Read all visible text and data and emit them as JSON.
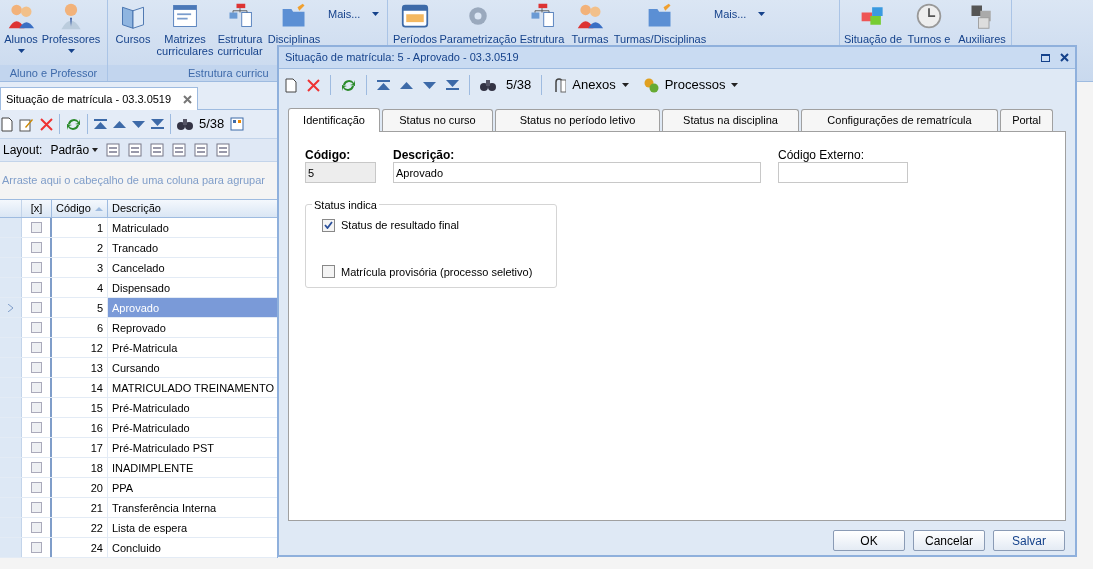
{
  "ribbon": {
    "groups": [
      {
        "label": "Aluno e Professor",
        "buttons": [
          {
            "label": "Alunos",
            "dropdown": true
          },
          {
            "label": "Professores",
            "dropdown": true
          }
        ]
      },
      {
        "label": "Estrutura curricu",
        "buttons": [
          {
            "label": "Cursos",
            "dropdown": false
          },
          {
            "label": "Matrizes curriculares",
            "dropdown": false
          },
          {
            "label": "Estrutura curricular",
            "dropdown": false
          },
          {
            "label": "Disciplinas",
            "dropdown": false
          }
        ],
        "more": "Mais..."
      },
      {
        "buttons": [
          {
            "label": "Períodos",
            "dropdown": false
          },
          {
            "label": "Parametrização",
            "dropdown": false
          },
          {
            "label": "Estrutura",
            "dropdown": false
          },
          {
            "label": "Turmas",
            "dropdown": false
          },
          {
            "label": "Turmas/Disciplinas",
            "dropdown": false
          }
        ],
        "more": "Mais..."
      },
      {
        "buttons": [
          {
            "label": "Situação de",
            "dropdown": false
          },
          {
            "label": "Turnos e",
            "dropdown": false
          },
          {
            "label": "Auxiliares",
            "dropdown": false
          }
        ]
      }
    ]
  },
  "document_tab": {
    "title": "Situação de matrícula - 03.3.0519"
  },
  "toolbar": {
    "record_counter": "5/38"
  },
  "layout_bar": {
    "label": "Layout:",
    "preset": "Padrão"
  },
  "group_panel": {
    "hint": "Arraste aqui o cabeçalho de uma coluna para agrupar"
  },
  "grid": {
    "columns": [
      "[x]",
      "Código",
      "Descrição"
    ],
    "rows": [
      {
        "code": "1",
        "description": "Matriculado",
        "checked": false,
        "selected": false
      },
      {
        "code": "2",
        "description": "Trancado",
        "checked": false,
        "selected": false
      },
      {
        "code": "3",
        "description": "Cancelado",
        "checked": false,
        "selected": false
      },
      {
        "code": "4",
        "description": "Dispensado",
        "checked": false,
        "selected": false
      },
      {
        "code": "5",
        "description": "Aprovado",
        "checked": false,
        "selected": true
      },
      {
        "code": "6",
        "description": "Reprovado",
        "checked": false,
        "selected": false
      },
      {
        "code": "12",
        "description": "Pré-Matricula",
        "checked": false,
        "selected": false
      },
      {
        "code": "13",
        "description": "Cursando",
        "checked": false,
        "selected": false
      },
      {
        "code": "14",
        "description": "MATRICULADO TREINAMENTO",
        "checked": false,
        "selected": false
      },
      {
        "code": "15",
        "description": "Pré-Matriculado",
        "checked": false,
        "selected": false
      },
      {
        "code": "16",
        "description": "Pré-Matriculado",
        "checked": false,
        "selected": false
      },
      {
        "code": "17",
        "description": "Pré-Matriculado PST",
        "checked": false,
        "selected": false
      },
      {
        "code": "18",
        "description": "INADIMPLENTE",
        "checked": false,
        "selected": false
      },
      {
        "code": "20",
        "description": "PPA",
        "checked": false,
        "selected": false
      },
      {
        "code": "21",
        "description": "Transferência Interna",
        "checked": false,
        "selected": false
      },
      {
        "code": "22",
        "description": "Lista de espera",
        "checked": false,
        "selected": false
      },
      {
        "code": "24",
        "description": "Concluido",
        "checked": false,
        "selected": false
      }
    ]
  },
  "dialog": {
    "title": "Situação de matrícula: 5 - Aprovado - 03.3.0519",
    "toolbar": {
      "record_counter": "5/38",
      "menus": [
        "Anexos",
        "Processos"
      ]
    },
    "tabs": [
      {
        "label": "Identificação",
        "selected": true
      },
      {
        "label": "Status no curso",
        "selected": false
      },
      {
        "label": "Status no período letivo",
        "selected": false
      },
      {
        "label": "Status na disciplina",
        "selected": false
      },
      {
        "label": "Configurações de rematrícula",
        "selected": false
      },
      {
        "label": "Portal",
        "selected": false
      }
    ],
    "fields": [
      {
        "label": "Código:",
        "value": "5",
        "disabled": true
      },
      {
        "label": "Descrição:",
        "value": "Aprovado",
        "disabled": false
      },
      {
        "label": "Código Externo:",
        "disabled": false
      }
    ],
    "status_group": {
      "title": "Status indica",
      "options": [
        {
          "label": "Status de resultado final",
          "checked": true
        },
        {
          "label": "Matrícula provisória (processo seletivo)",
          "checked": false
        }
      ]
    },
    "buttons": [
      "OK",
      "Cancelar",
      "Salvar"
    ]
  }
}
